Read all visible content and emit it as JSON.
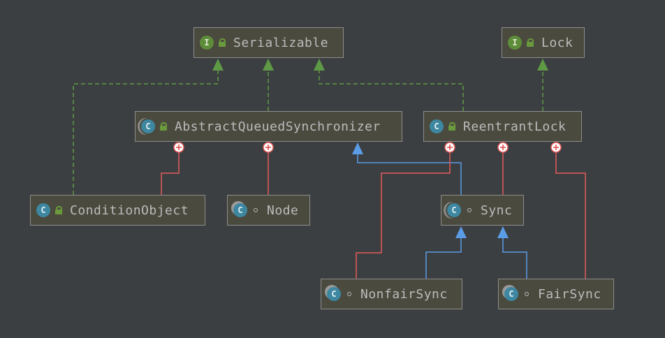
{
  "nodes": {
    "serializable": {
      "name": "Serializable",
      "kind": "interface",
      "kind_letter": "I",
      "visibility": "public"
    },
    "lock": {
      "name": "Lock",
      "kind": "interface",
      "kind_letter": "I",
      "visibility": "public"
    },
    "aqs": {
      "name": "AbstractQueuedSynchronizer",
      "kind": "abstract-class",
      "kind_letter": "C",
      "visibility": "public"
    },
    "reentrant_lock": {
      "name": "ReentrantLock",
      "kind": "class",
      "kind_letter": "C",
      "visibility": "public"
    },
    "condition_object": {
      "name": "ConditionObject",
      "kind": "class",
      "kind_letter": "C",
      "visibility": "public"
    },
    "node": {
      "name": "Node",
      "kind": "static-class",
      "kind_letter": "C",
      "visibility": "package"
    },
    "sync": {
      "name": "Sync",
      "kind": "abstract-static-class",
      "kind_letter": "C",
      "visibility": "package"
    },
    "nonfair_sync": {
      "name": "NonfairSync",
      "kind": "static-class",
      "kind_letter": "C",
      "visibility": "package"
    },
    "fair_sync": {
      "name": "FairSync",
      "kind": "static-class",
      "kind_letter": "C",
      "visibility": "package"
    }
  },
  "relations": [
    {
      "type": "implements",
      "from": "condition_object",
      "to": "serializable"
    },
    {
      "type": "implements",
      "from": "aqs",
      "to": "serializable"
    },
    {
      "type": "implements",
      "from": "reentrant_lock",
      "to": "serializable"
    },
    {
      "type": "implements",
      "from": "reentrant_lock",
      "to": "lock"
    },
    {
      "type": "extends",
      "from": "sync",
      "to": "aqs"
    },
    {
      "type": "extends",
      "from": "nonfair_sync",
      "to": "sync"
    },
    {
      "type": "extends",
      "from": "fair_sync",
      "to": "sync"
    },
    {
      "type": "inner",
      "from": "condition_object",
      "to": "aqs"
    },
    {
      "type": "inner",
      "from": "node",
      "to": "aqs"
    },
    {
      "type": "inner",
      "from": "nonfair_sync",
      "to": "reentrant_lock"
    },
    {
      "type": "inner",
      "from": "sync",
      "to": "reentrant_lock"
    },
    {
      "type": "inner",
      "from": "fair_sync",
      "to": "reentrant_lock"
    }
  ],
  "colors": {
    "background": "#3c3f41",
    "implements": "#5e9a46",
    "extends": "#5a9ce6",
    "inner": "#e45b5b"
  },
  "icons": {
    "interface": "interface-badge-icon",
    "class": "class-badge-icon",
    "public": "open-lock-icon",
    "package": "package-visibility-icon",
    "inner_marker": "circle-plus-icon"
  }
}
